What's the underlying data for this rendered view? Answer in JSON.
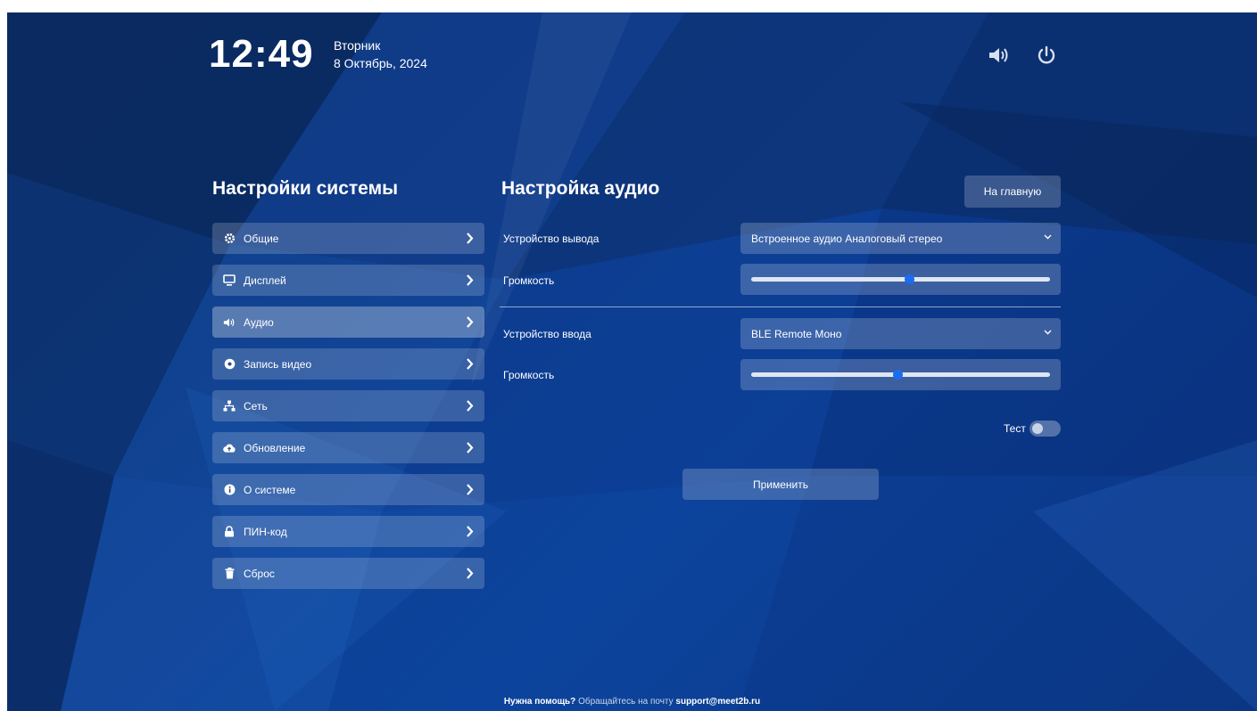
{
  "header": {
    "time": "12:49",
    "weekday": "Вторник",
    "date": "8 Октябрь, 2024"
  },
  "icons": {
    "volume": "volume-icon",
    "power": "power-icon"
  },
  "sidebar": {
    "title": "Настройки системы",
    "items": [
      {
        "label": "Общие",
        "icon": "gear-icon"
      },
      {
        "label": "Дисплей",
        "icon": "monitor-icon"
      },
      {
        "label": "Аудио",
        "icon": "speaker-icon"
      },
      {
        "label": "Запись видео",
        "icon": "record-icon"
      },
      {
        "label": "Сеть",
        "icon": "network-icon"
      },
      {
        "label": "Обновление",
        "icon": "cloud-upload-icon"
      },
      {
        "label": "О системе",
        "icon": "info-icon"
      },
      {
        "label": "ПИН-код",
        "icon": "lock-icon"
      },
      {
        "label": "Сброс",
        "icon": "trash-icon"
      }
    ],
    "active_index": 2
  },
  "main": {
    "title": "Настройка аудио",
    "home_button": "На главную",
    "output_label": "Устройство вывода",
    "output_value": "Встроенное аудио Аналоговый стерео",
    "output_volume_label": "Громкость",
    "output_volume_fraction": 0.53,
    "input_label": "Устройство ввода",
    "input_value": "BLE Remote Моно",
    "input_volume_label": "Громкость",
    "input_volume_fraction": 0.49,
    "test_label": "Тест",
    "test_on": false,
    "apply_button": "Применить"
  },
  "footer": {
    "help": "Нужна помощь?",
    "text": " Обращайтесь на почту ",
    "email": "support@meet2b.ru"
  },
  "colors": {
    "accent": "#1a6cf0",
    "background": "#0b3a86"
  }
}
